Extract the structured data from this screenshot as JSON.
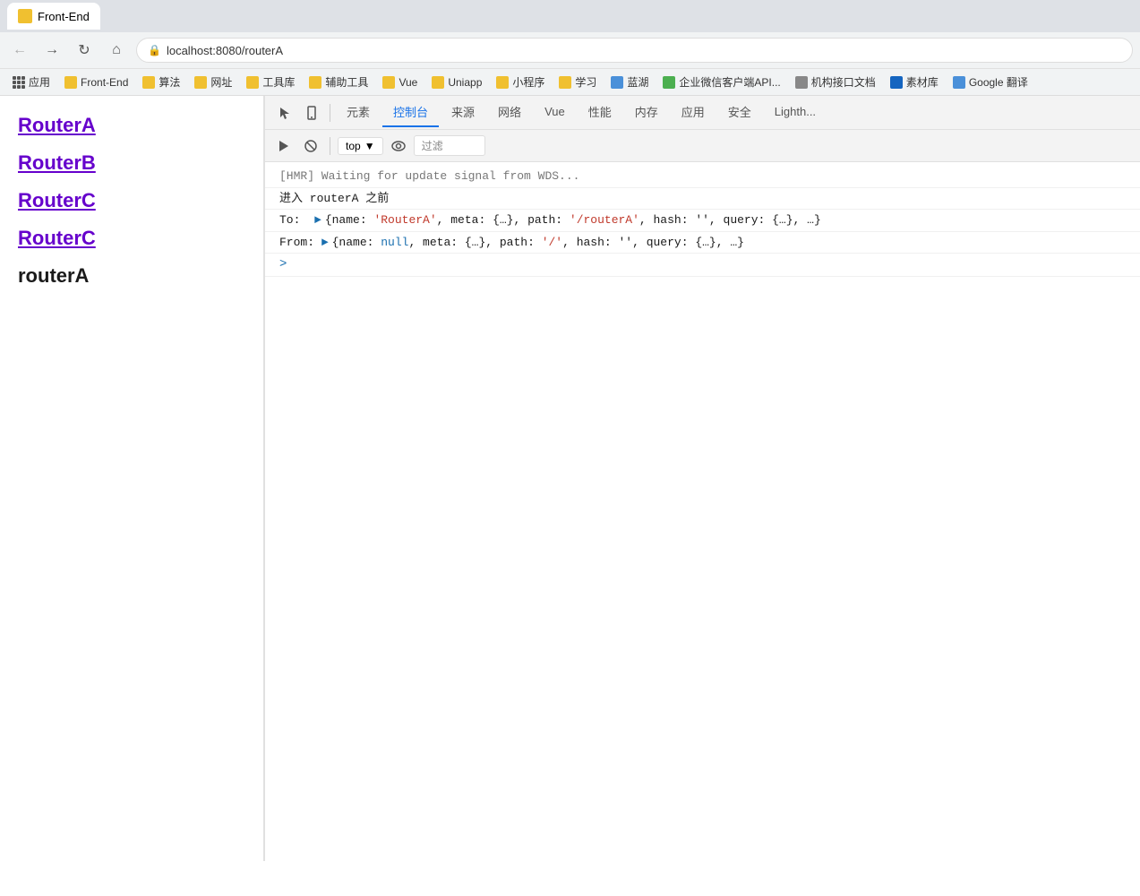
{
  "browser": {
    "url": "localhost:8080/routerA",
    "tab_title": "Front-End"
  },
  "bookmarks": [
    {
      "label": "应用",
      "color": "fav-orange"
    },
    {
      "label": "Front-End",
      "color": "fav-yellow"
    },
    {
      "label": "算法",
      "color": "fav-yellow"
    },
    {
      "label": "网址",
      "color": "fav-yellow"
    },
    {
      "label": "工具库",
      "color": "fav-yellow"
    },
    {
      "label": "辅助工具",
      "color": "fav-yellow"
    },
    {
      "label": "Vue",
      "color": "fav-yellow"
    },
    {
      "label": "Uniapp",
      "color": "fav-yellow"
    },
    {
      "label": "小程序",
      "color": "fav-yellow"
    },
    {
      "label": "学习",
      "color": "fav-yellow"
    },
    {
      "label": "蓝湖",
      "color": "fav-blue"
    },
    {
      "label": "企业微信客户端API...",
      "color": "fav-green"
    },
    {
      "label": "机构接口文档",
      "color": "fav-gray"
    },
    {
      "label": "素材库",
      "color": "fav-darkblue"
    },
    {
      "label": "Google 翻译",
      "color": "fav-blue"
    }
  ],
  "page": {
    "links": [
      "RouterA",
      "RouterB",
      "RouterC",
      "RouterC"
    ],
    "current": "routerA"
  },
  "devtools": {
    "tabs": [
      "元素",
      "控制台",
      "来源",
      "网络",
      "Vue",
      "性能",
      "内存",
      "应用",
      "安全",
      "Lighth..."
    ],
    "active_tab": "控制台",
    "toolbar": {
      "top_label": "top",
      "filter_placeholder": "过滤"
    },
    "console": [
      {
        "type": "log",
        "text": "[HMR] Waiting for update signal from WDS...",
        "color": "gray"
      },
      {
        "type": "log",
        "text": "进入 routerA 之前",
        "color": "black"
      },
      {
        "type": "log",
        "parts": [
          {
            "text": "To:  ",
            "color": "black"
          },
          {
            "text": "▶",
            "color": "blue",
            "arrow": true
          },
          {
            "text": "{name: ",
            "color": "black"
          },
          {
            "text": "'RouterA'",
            "color": "red"
          },
          {
            "text": ", meta: {…}, path: ",
            "color": "black"
          },
          {
            "text": "'/routerA'",
            "color": "red"
          },
          {
            "text": ", hash: '', query: {…}, …}",
            "color": "black"
          }
        ]
      },
      {
        "type": "log",
        "parts": [
          {
            "text": "From: ",
            "color": "black"
          },
          {
            "text": "▶",
            "color": "blue",
            "arrow": true
          },
          {
            "text": "{name: ",
            "color": "black"
          },
          {
            "text": "null",
            "color": "blue"
          },
          {
            "text": ", meta: {…}, path: ",
            "color": "black"
          },
          {
            "text": "'/'",
            "color": "red"
          },
          {
            "text": ", hash: '', query: {…}, …}",
            "color": "black"
          }
        ]
      },
      {
        "type": "prompt",
        "text": ""
      }
    ]
  }
}
